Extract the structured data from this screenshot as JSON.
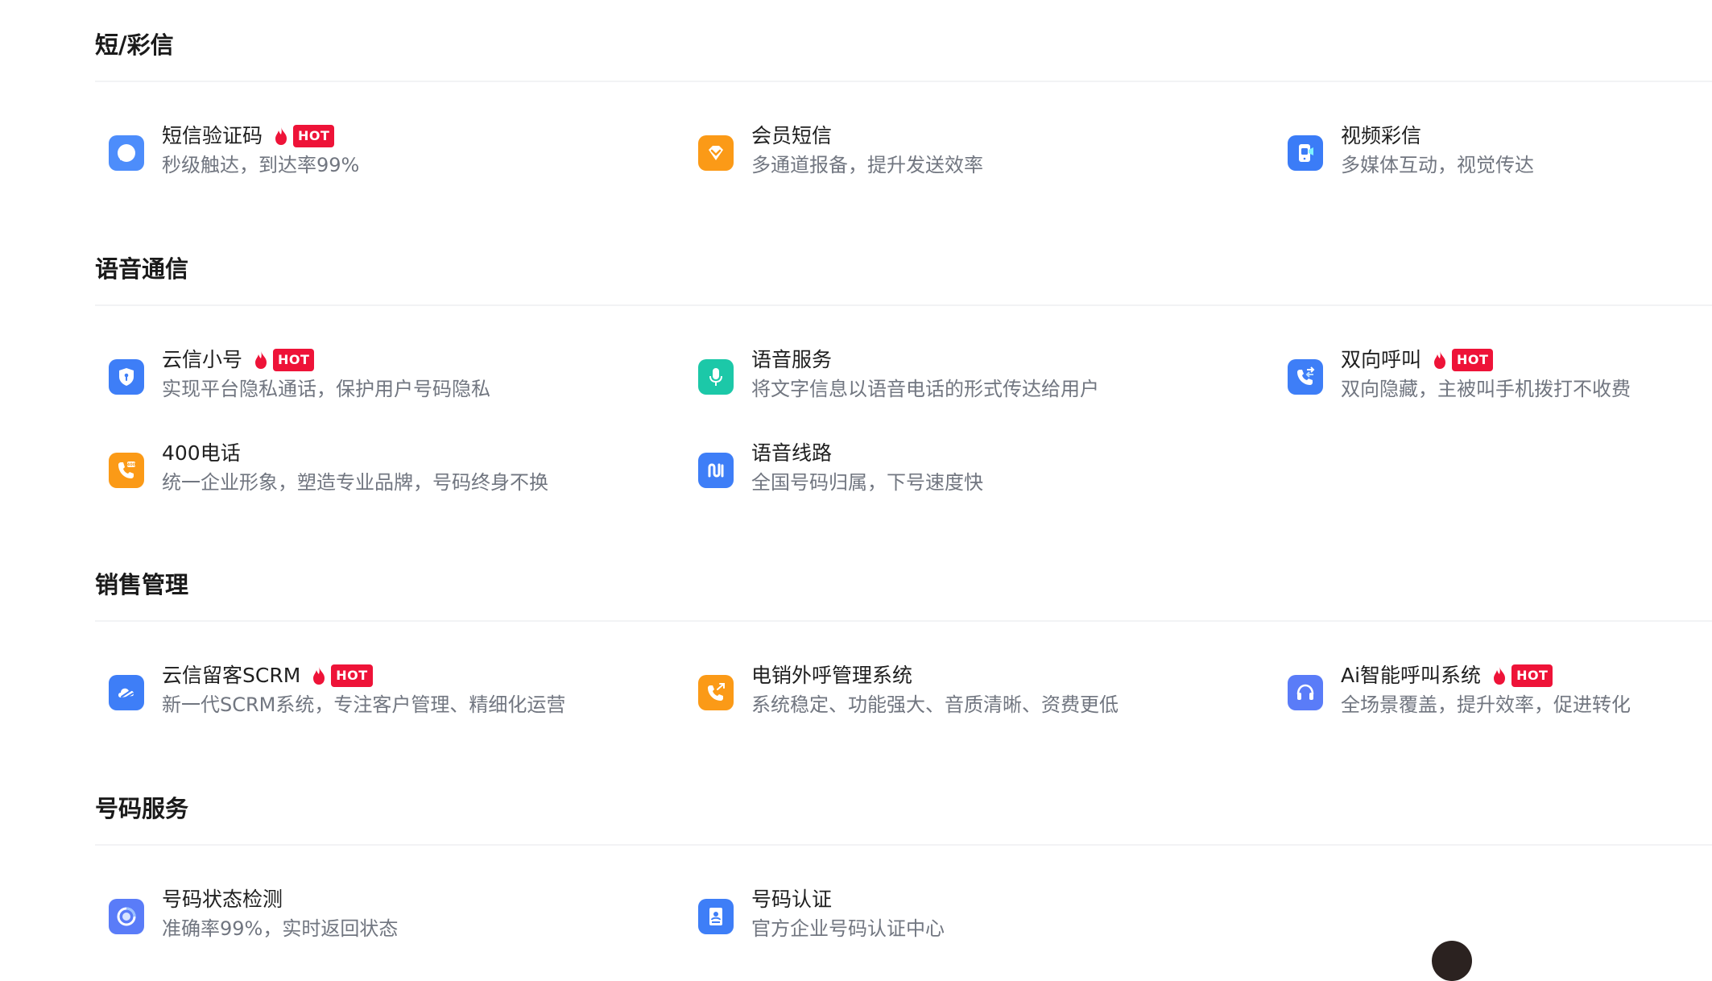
{
  "hot_label": "HOT",
  "sections": [
    {
      "title": "短/彩信",
      "items": [
        {
          "name": "短信验证码",
          "desc": "秒级触达，到达率99%",
          "hot": true,
          "icon": "chat-bubble-icon",
          "color": "#4d8dfb"
        },
        {
          "name": "会员短信",
          "desc": "多通道报备，提升发送效率",
          "hot": false,
          "icon": "diamond-icon",
          "color": "#fb9a17"
        },
        {
          "name": "视频彩信",
          "desc": "多媒体互动，视觉传达",
          "hot": false,
          "icon": "phone-video-icon",
          "color": "#3b7cf7"
        }
      ]
    },
    {
      "title": "语音通信",
      "items": [
        {
          "name": "云信小号",
          "desc": "实现平台隐私通话，保护用户号码隐私",
          "hot": true,
          "icon": "shield-icon",
          "color": "#3e7ef7"
        },
        {
          "name": "语音服务",
          "desc": "将文字信息以语音电话的形式传达给用户",
          "hot": false,
          "icon": "microphone-icon",
          "color": "#1cc8a8"
        },
        {
          "name": "双向呼叫",
          "desc": "双向隐藏，主被叫手机拨打不收费",
          "hot": true,
          "icon": "phone-transfer-icon",
          "color": "#3e7ef7"
        },
        {
          "name": "400电话",
          "desc": "统一企业形象，塑造专业品牌，号码终身不换",
          "hot": false,
          "icon": "phone-400-icon",
          "color": "#fb9a17"
        },
        {
          "name": "语音线路",
          "desc": "全国号码归属，下号速度快",
          "hot": false,
          "icon": "line-route-icon",
          "color": "#3e7ef7"
        }
      ]
    },
    {
      "title": "销售管理",
      "items": [
        {
          "name": "云信留客SCRM",
          "desc": "新一代SCRM系统，专注客户管理、精细化运营",
          "hot": true,
          "icon": "cloud-link-icon",
          "color": "#3e7ef7"
        },
        {
          "name": "电销外呼管理系统",
          "desc": "系统稳定、功能强大、音质清晰、资费更低",
          "hot": false,
          "icon": "outbound-call-icon",
          "color": "#fb9a17"
        },
        {
          "name": "Ai智能呼叫系统",
          "desc": "全场景覆盖，提升效率，促进转化",
          "hot": true,
          "icon": "headset-icon",
          "color": "#5a7cf8"
        }
      ]
    },
    {
      "title": "号码服务",
      "items": [
        {
          "name": "号码状态检测",
          "desc": "准确率99%，实时返回状态",
          "hot": false,
          "icon": "status-ring-icon",
          "color": "#5a7cf8"
        },
        {
          "name": "号码认证",
          "desc": "官方企业号码认证中心",
          "hot": false,
          "icon": "id-badge-icon",
          "color": "#3e7ef7"
        }
      ]
    }
  ]
}
